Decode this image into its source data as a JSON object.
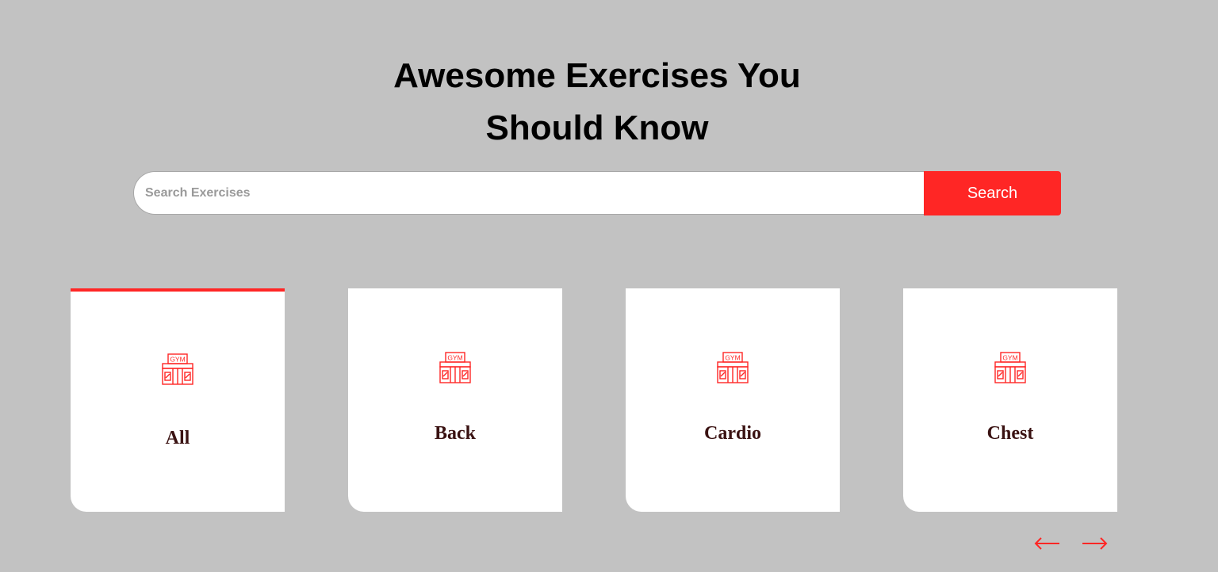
{
  "header": {
    "title_line1": "Awesome Exercises You",
    "title_line2": "Should Know"
  },
  "search": {
    "placeholder": "Search Exercises",
    "value": "",
    "button_label": "Search"
  },
  "categories": [
    {
      "label": "All",
      "icon": "gym-icon",
      "active": true
    },
    {
      "label": "Back",
      "icon": "gym-icon",
      "active": false
    },
    {
      "label": "Cardio",
      "icon": "gym-icon",
      "active": false
    },
    {
      "label": "Chest",
      "icon": "gym-icon",
      "active": false
    }
  ],
  "icon_text": "GYM",
  "pagination": {
    "prev_icon": "arrow-left-icon",
    "next_icon": "arrow-right-icon"
  },
  "colors": {
    "background": "#c2c2c2",
    "accent": "#ff2625",
    "card": "#ffffff",
    "label": "#3a1212"
  }
}
